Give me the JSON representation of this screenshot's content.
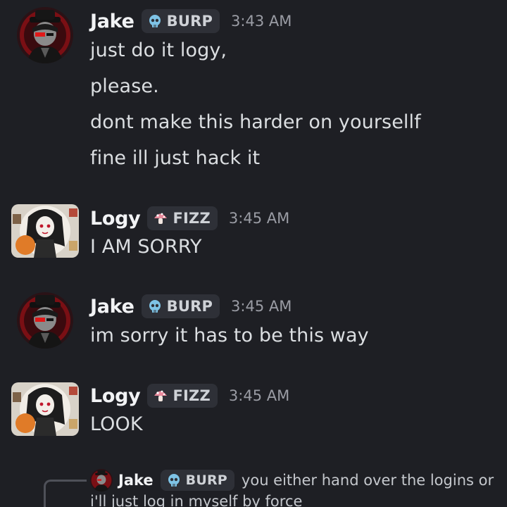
{
  "colors": {
    "background": "#1e1f24",
    "tag_bg": "#2e3037",
    "text": "#dbdee1",
    "timestamp": "#9a9ca4",
    "burp_icon": "#7ec3e6",
    "fizz_icon": "#e88a9c"
  },
  "messages": [
    {
      "author": "Jake",
      "tag": "BURP",
      "tag_icon": "skull-icon",
      "time": "3:43 AM",
      "lines": [
        "just do it logy,",
        "please.",
        "dont make this harder on yoursellf",
        "fine ill just hack it"
      ]
    },
    {
      "author": "Logy",
      "tag": "FIZZ",
      "tag_icon": "mushroom-icon",
      "time": "3:45 AM",
      "lines": [
        "I AM SORRY"
      ]
    },
    {
      "author": "Jake",
      "tag": "BURP",
      "tag_icon": "skull-icon",
      "time": "3:45 AM",
      "lines": [
        "im sorry it has to be this way"
      ]
    },
    {
      "author": "Logy",
      "tag": "FIZZ",
      "tag_icon": "mushroom-icon",
      "time": "3:45 AM",
      "lines": [
        "LOOK"
      ]
    }
  ],
  "reply": {
    "author": "Jake",
    "tag": "BURP",
    "text": "you either hand over the logins or",
    "text_cont": "i'll just log in myself by force"
  }
}
